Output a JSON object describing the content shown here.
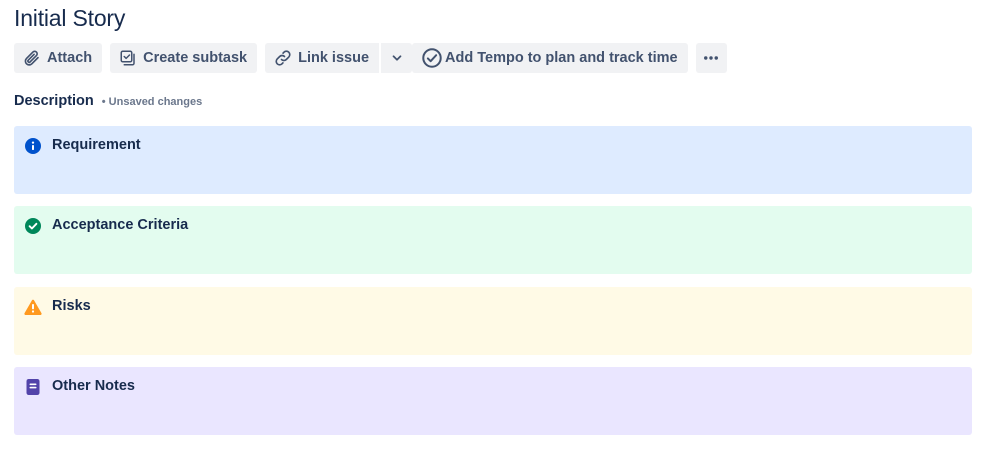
{
  "issue": {
    "title": "Initial Story"
  },
  "toolbar": {
    "attach_label": "Attach",
    "create_subtask_label": "Create subtask",
    "link_issue_label": "Link issue",
    "tempo_label": "Add Tempo to plan and track time"
  },
  "description": {
    "label": "Description",
    "unsaved": "• Unsaved changes"
  },
  "panels": [
    {
      "kind": "info",
      "icon": "info-icon",
      "color": "#0052cc",
      "background": "#deebff",
      "text": "Requirement"
    },
    {
      "kind": "success",
      "icon": "check-circle-icon",
      "color": "#00875a",
      "background": "#e3fcef",
      "text": "Acceptance Criteria"
    },
    {
      "kind": "warning",
      "icon": "warning-icon",
      "color": "#ff991f",
      "background": "#fffae6",
      "text": "Risks"
    },
    {
      "kind": "note",
      "icon": "note-icon",
      "color": "#5243aa",
      "background": "#eae6ff",
      "text": "Other Notes"
    }
  ]
}
